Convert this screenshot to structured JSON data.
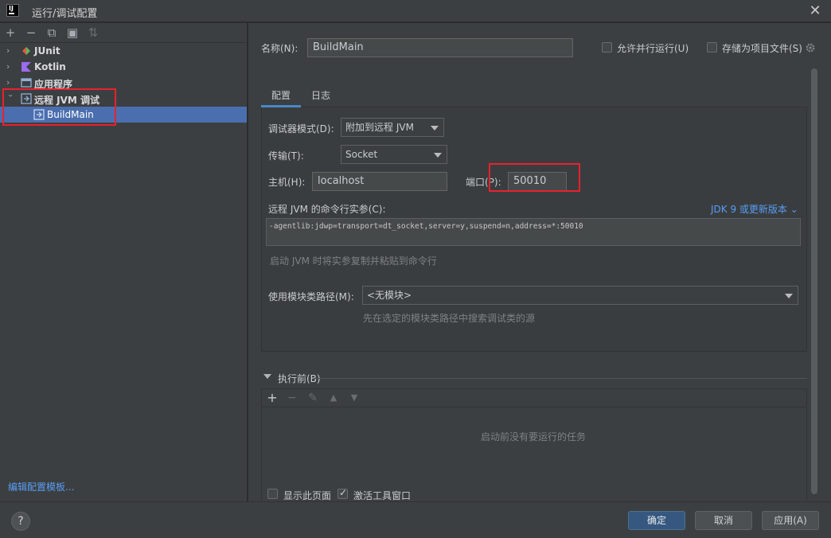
{
  "window": {
    "title": "运行/调试配置",
    "logo_text": "IJ",
    "close": "✕"
  },
  "left": {
    "toolbar": [
      "+",
      "−",
      "⧉",
      "▣",
      "⇅"
    ],
    "tree": [
      {
        "label": "JUnit",
        "icon_color": "#e05a3c"
      },
      {
        "label": "Kotlin",
        "icon_color": "#a27cf3"
      },
      {
        "label": "应用程序",
        "icon_color": "#7aa1c9"
      },
      {
        "label": "远程 JVM 调试",
        "icon_color": "#7aa1c9"
      },
      {
        "label": "BuildMain",
        "icon_color": "#a5c3e6"
      }
    ],
    "edit_templates": "编辑配置模板..."
  },
  "form": {
    "name_label": "名称(N):",
    "name_value": "BuildMain",
    "allow_parallel": "允许并行运行(U)",
    "store_as_file": "存储为项目文件(S)",
    "tabs": [
      "配置",
      "日志"
    ],
    "debugger_mode_label": "调试器模式(D):",
    "debugger_mode_value": "附加到远程 JVM",
    "transport_label": "传输(T):",
    "transport_value": "Socket",
    "host_label": "主机(H):",
    "host_value": "localhost",
    "port_label": "端口(P):",
    "port_value": "50010",
    "cmd_args_label": "远程 JVM 的命令行实参(C):",
    "jdk_link": "JDK 9 或更新版本",
    "cmd_args_value": "-agentlib:jdwp=transport=dt_socket,server=y,suspend=n,address=*:50010",
    "cmd_hint": "启动 JVM 时将实参复制并粘贴到命令行",
    "module_label": "使用模块类路径(M):",
    "module_value": "<无模块>",
    "module_hint": "先在选定的模块类路径中搜索调试类的源",
    "before_launch": "执行前(B)",
    "before_launch_empty": "启动前没有要运行的任务",
    "show_page": "显示此页面",
    "activate_tool": "激活工具窗口"
  },
  "buttons": {
    "help": "?",
    "ok": "确定",
    "cancel": "取消",
    "apply": "应用(A)"
  }
}
